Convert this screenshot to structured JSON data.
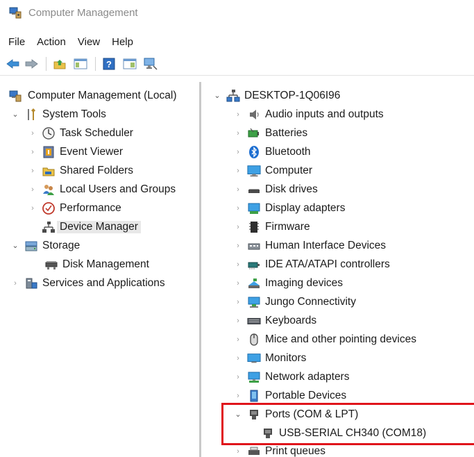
{
  "window": {
    "title": "Computer Management"
  },
  "menu": [
    "File",
    "Action",
    "View",
    "Help"
  ],
  "left_tree": {
    "root": "Computer Management (Local)",
    "system_tools": "System Tools",
    "task_scheduler": "Task Scheduler",
    "event_viewer": "Event Viewer",
    "shared_folders": "Shared Folders",
    "local_users": "Local Users and Groups",
    "performance": "Performance",
    "device_manager": "Device Manager",
    "storage": "Storage",
    "disk_management": "Disk Management",
    "services": "Services and Applications"
  },
  "right_tree": {
    "computer_name": "DESKTOP-1Q06I96",
    "categories": [
      "Audio inputs and outputs",
      "Batteries",
      "Bluetooth",
      "Computer",
      "Disk drives",
      "Display adapters",
      "Firmware",
      "Human Interface Devices",
      "IDE ATA/ATAPI controllers",
      "Imaging devices",
      "Jungo Connectivity",
      "Keyboards",
      "Mice and other pointing devices",
      "Monitors",
      "Network adapters",
      "Portable Devices",
      "Ports (COM & LPT)",
      "Print queues"
    ],
    "port_device": "USB-SERIAL CH340 (COM18)"
  },
  "colors": {
    "highlight_box": "#e0141b",
    "selected_row": "#e8e8e8"
  }
}
